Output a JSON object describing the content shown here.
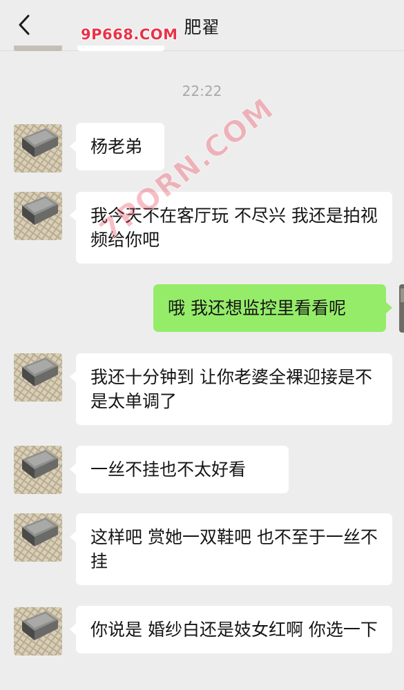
{
  "header": {
    "back_icon": "chevron-left-icon",
    "title": "肥翟"
  },
  "watermarks": {
    "top": "9P668.COM",
    "diagonal": "7PORN.COM"
  },
  "time": "22:22",
  "messages": [
    {
      "side": "in",
      "text": "杨老弟"
    },
    {
      "side": "in",
      "text": "我今天不在客厅玩 不尽兴 我还是拍视频给你吧"
    },
    {
      "side": "out",
      "text": "哦 我还想监控里看看呢"
    },
    {
      "side": "in",
      "text": "我还十分钟到 让你老婆全裸迎接是不是太单调了"
    },
    {
      "side": "in",
      "text": "一丝不挂也不太好看"
    },
    {
      "side": "in",
      "text": "这样吧 赏她一双鞋吧 也不至于一丝不挂"
    },
    {
      "side": "in",
      "text": "你说是 婚纱白还是妓女红啊 你选一下"
    }
  ],
  "colors": {
    "background": "#ededed",
    "incoming_bubble": "#ffffff",
    "outgoing_bubble": "#95ec69",
    "watermark": "#e8344a"
  }
}
